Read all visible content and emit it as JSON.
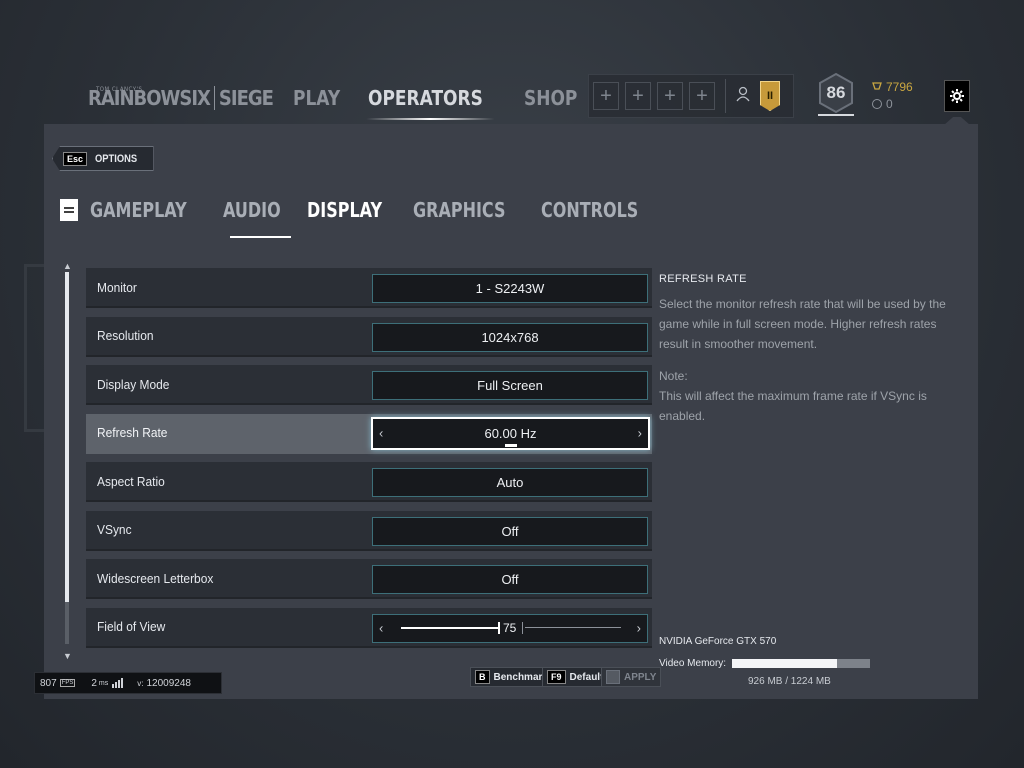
{
  "logo": {
    "tagline": "TOM CLANCY'S",
    "brand": "RAINBOWSIX",
    "sub": "SIEGE"
  },
  "nav": {
    "items": [
      "PLAY",
      "OPERATORS",
      "SHOP"
    ],
    "active": "OPERATORS"
  },
  "squad": {
    "slot_glyph": "+"
  },
  "player": {
    "level": "86",
    "renown": "7796",
    "credits": "0",
    "rank_badge": "II"
  },
  "options_button": {
    "key": "Esc",
    "label": "OPTIONS"
  },
  "tabs": [
    "GAMEPLAY",
    "AUDIO",
    "DISPLAY",
    "GRAPHICS",
    "CONTROLS"
  ],
  "active_tab": "DISPLAY",
  "settings": [
    {
      "label": "Monitor",
      "value": "1 - S2243W"
    },
    {
      "label": "Resolution",
      "value": "1024x768"
    },
    {
      "label": "Display Mode",
      "value": "Full Screen"
    },
    {
      "label": "Refresh Rate",
      "value": "60.00 Hz",
      "selected": true
    },
    {
      "label": "Aspect Ratio",
      "value": "Auto"
    },
    {
      "label": "VSync",
      "value": "Off"
    },
    {
      "label": "Widescreen Letterbox",
      "value": "Off"
    },
    {
      "label": "Field of View",
      "value": "75",
      "slider_fraction": 0.4
    }
  ],
  "description": {
    "title": "REFRESH RATE",
    "body": "Select the monitor refresh rate that will be used by the game while in full screen mode. Higher refresh rates result in smoother movement.",
    "note_label": "Note:",
    "note": "This will affect the maximum frame rate if VSync is enabled."
  },
  "gpu": {
    "name": "NVIDIA GeForce GTX 570",
    "memory_label": "Video Memory:",
    "memory_used_fraction": 0.757,
    "memory_text": "926 MB / 1224 MB"
  },
  "buttons": {
    "benchmark": {
      "key": "B",
      "label": "Benchmark"
    },
    "default": {
      "key": "F9",
      "label": "Default"
    },
    "apply": {
      "key": "",
      "label": "APPLY"
    }
  },
  "perf": {
    "fps": "807",
    "fps_label": "FPS",
    "ping": "2",
    "ping_unit": "ms",
    "version_label": "v:",
    "version": "12009248"
  },
  "colors": {
    "accent_border": "#3d6f79",
    "renown": "#c9a641",
    "panel": "#3c4049"
  }
}
